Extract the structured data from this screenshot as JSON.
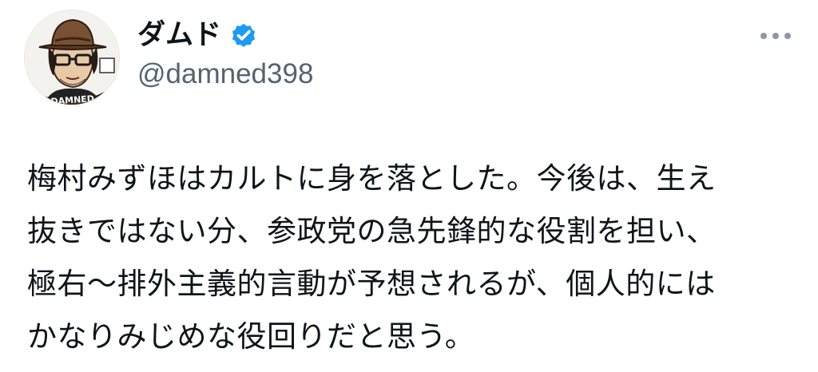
{
  "author": {
    "display_name": "ダムド",
    "handle": "@damned398",
    "verified": true,
    "avatar_text": "DAMNED",
    "avatar_icon": "caricature-avatar-with-hat-and-glasses"
  },
  "actions": {
    "more_icon": "ellipsis-horizontal-icon"
  },
  "tweet": {
    "lines": [
      "梅村みずほはカルトに身を落とした。今後は、生え",
      "抜きではない分、参政党の急先鋒的な役割を担い、",
      "極右〜排外主義的言動が予想されるが、個人的には",
      "かなりみじめな役回りだと思う。"
    ]
  },
  "colors": {
    "text": "#0f1419",
    "secondary": "#536471",
    "verified_blue": "#1d9bf0",
    "more_dots": "#8b98a5"
  }
}
